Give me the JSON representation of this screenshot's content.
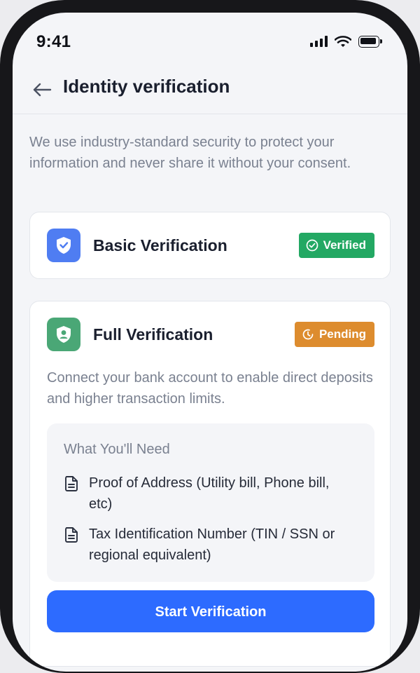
{
  "status_bar": {
    "time": "9:41",
    "icons": [
      "signal-icon",
      "wifi-icon",
      "battery-icon"
    ]
  },
  "header": {
    "back_icon": "arrow-left-icon",
    "title": "Identity verification"
  },
  "intro": "We use industry-standard security to protect your information and never share it without your consent.",
  "basic_card": {
    "icon": "shield-check-icon",
    "title": "Basic Verification",
    "badge_icon": "check-circle-icon",
    "badge": "Verified",
    "badge_color": "#23a863"
  },
  "full_card": {
    "icon": "user-shield-icon",
    "title": "Full Verification",
    "badge_icon": "clock-icon",
    "badge": "Pending",
    "badge_color": "#dd8c2e",
    "description": "Connect your bank account to enable direct deposits and higher transaction limits.",
    "needs": {
      "title": "What You'll Need",
      "items": [
        {
          "icon": "document-icon",
          "text": "Proof of Address (Utility bill, Phone bill, etc)"
        },
        {
          "icon": "document-icon",
          "text": "Tax Identification Number (TIN / SSN or regional equivalent)"
        }
      ]
    },
    "button_label": "Start Verification"
  },
  "colors": {
    "accent": "#2d6bff",
    "verified": "#23a863",
    "pending": "#dd8c2e",
    "basic_icon_bg": "#4f7df2",
    "full_icon_bg": "#4aa776"
  }
}
